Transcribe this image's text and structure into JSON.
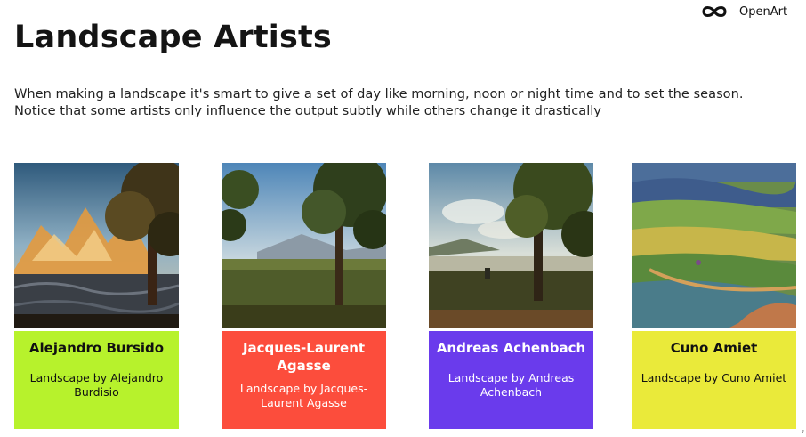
{
  "brand": {
    "name": "OpenArt",
    "logo_icon": "infinity-logo-icon"
  },
  "title": "Landscape Artists",
  "intro": "When making a landscape it's smart to give a set of day like morning, noon or night time and to set the season. Notice that some artists only influence the output subtly while others change it drastically",
  "cards": [
    {
      "name": "Alejandro Bursido",
      "description": "Landscape by Alejandro Burdisio",
      "color": "#b7f22c",
      "text_color": "#111111"
    },
    {
      "name": "Jacques-Laurent Agasse",
      "description": "Landscape by Jacques-Laurent Agasse",
      "color": "#fc4d3c",
      "text_color": "#ffffff"
    },
    {
      "name": "Andreas Achenbach",
      "description": "Landscape by Andreas Achenbach",
      "color": "#6a3bec",
      "text_color": "#ffffff"
    },
    {
      "name": "Cuno Amiet",
      "description": "Landscape by Cuno Amiet",
      "color": "#eaea3a",
      "text_color": "#111111"
    }
  ],
  "corner_mark": "⁷"
}
